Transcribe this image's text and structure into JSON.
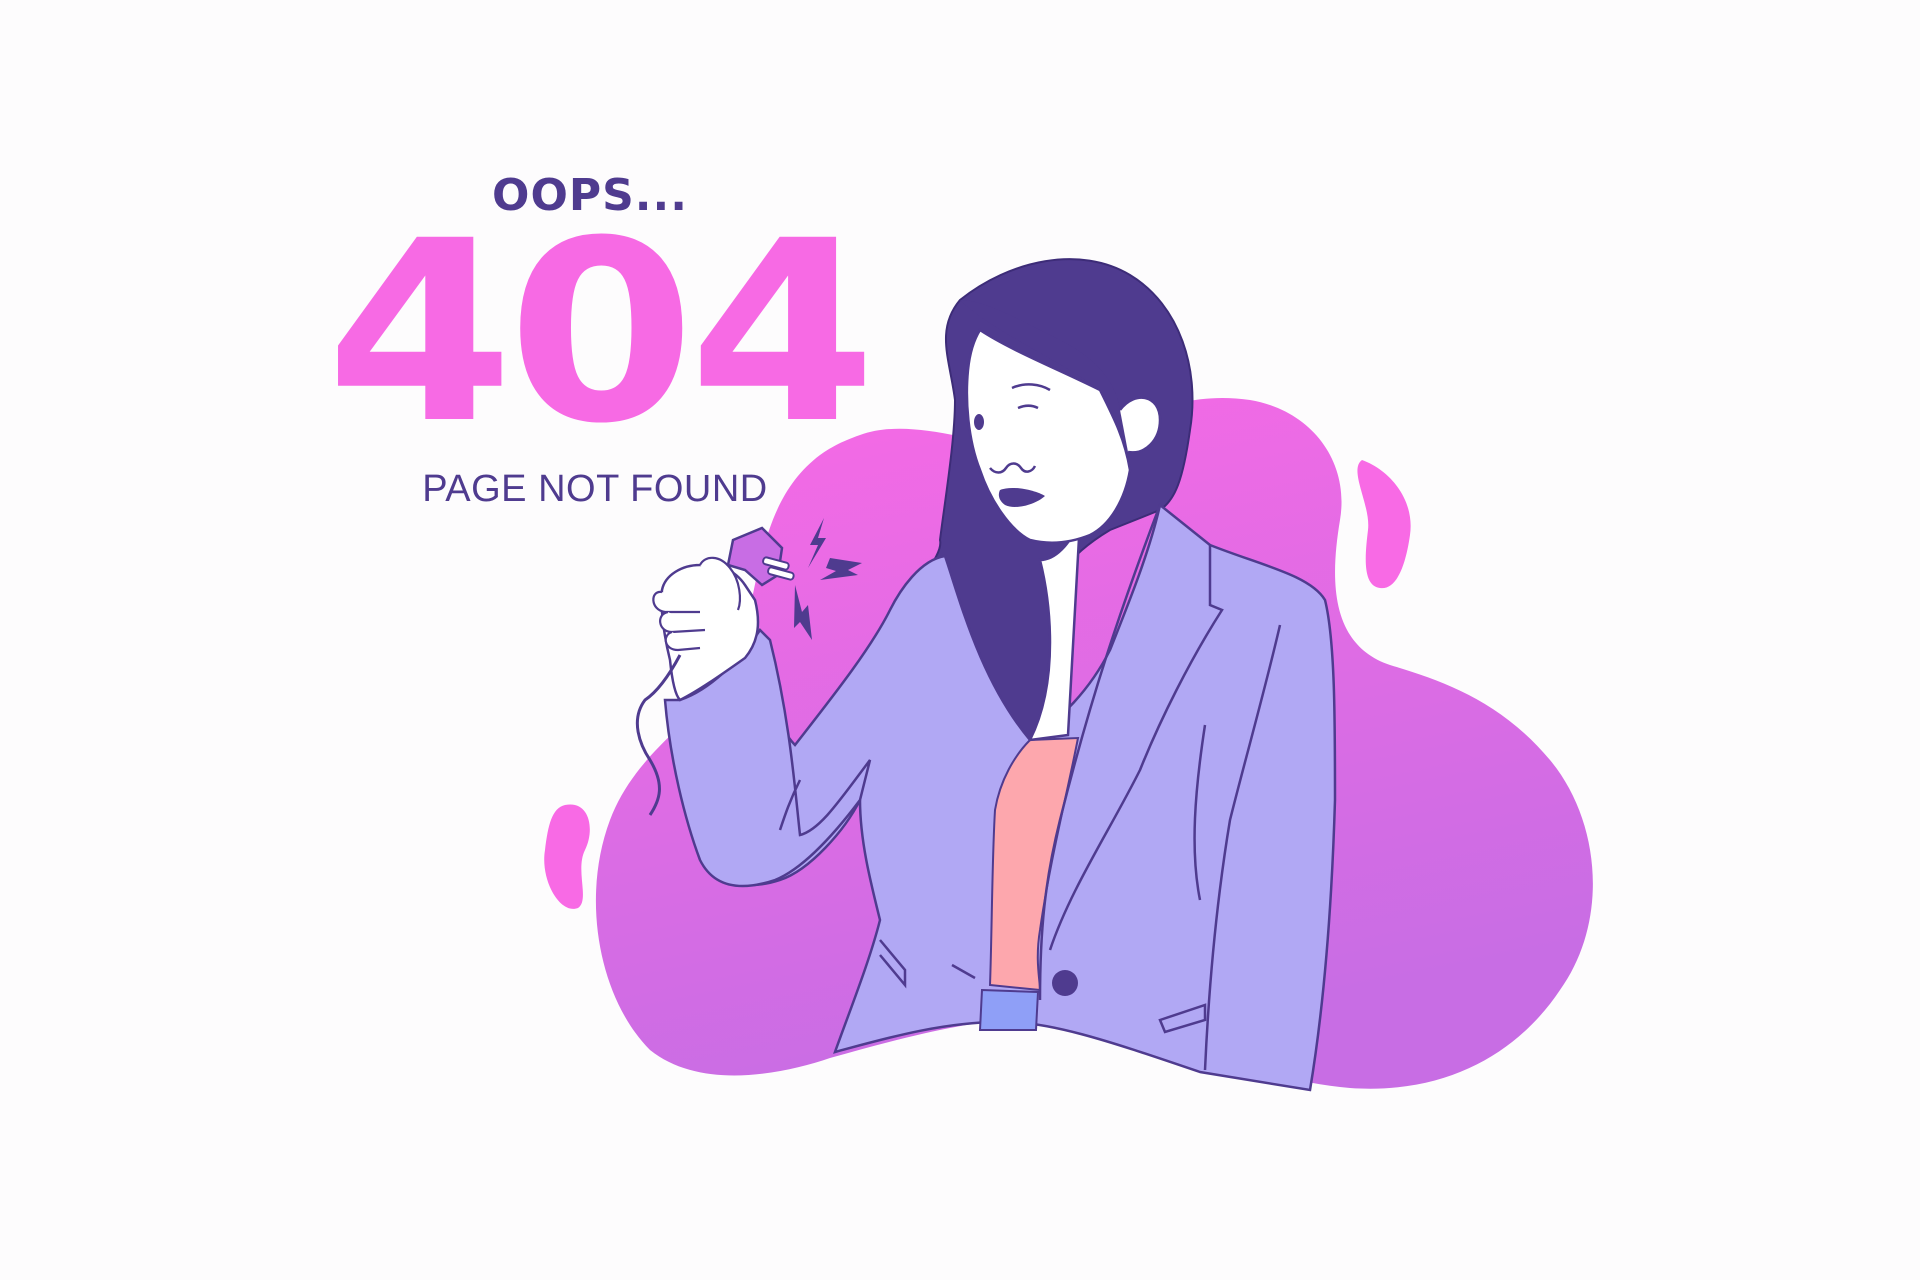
{
  "message": {
    "prefix": "OOPS...",
    "code": "404",
    "subtitle": "PAGE NOT FOUND"
  },
  "colors": {
    "accent_pink": "#f76ae4",
    "dark_purple": "#4f3b8f",
    "jacket_lavender": "#b1a8f4",
    "shirt_salmon": "#fda7ad",
    "background": "#fdfcfd"
  },
  "icons": [
    "unplugged-cable-icon",
    "electric-spark-icon"
  ]
}
